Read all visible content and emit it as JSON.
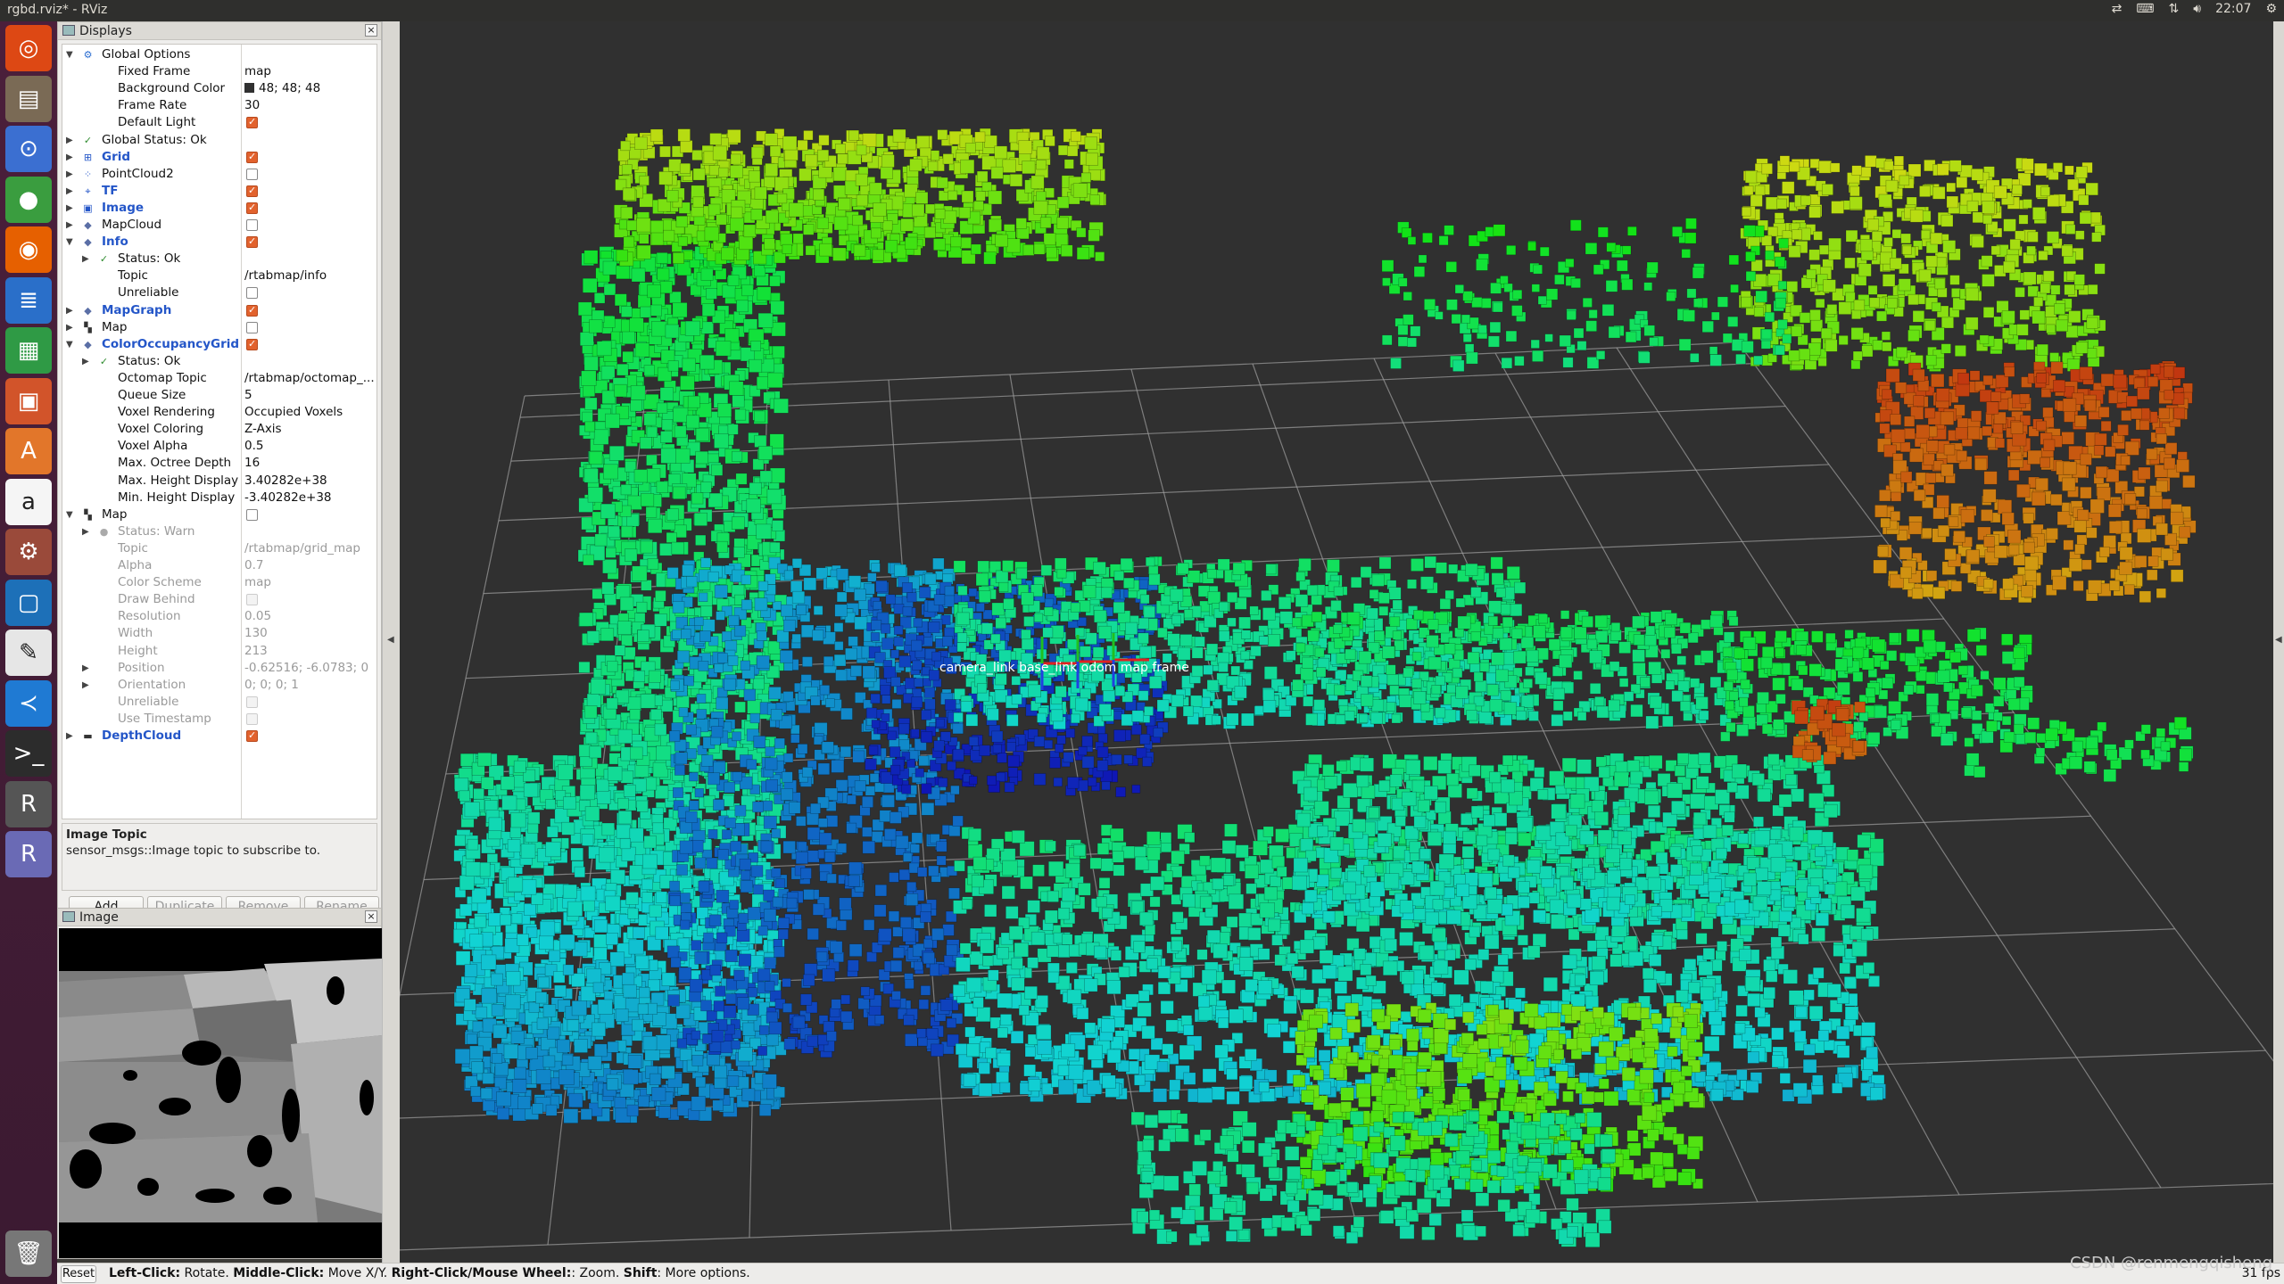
{
  "window": {
    "title": "rgbd.rviz* - RViz"
  },
  "tray": {
    "clock": "22:07"
  },
  "launcher": {
    "items": [
      "ubuntu-home",
      "files",
      "search",
      "chrome",
      "firefox",
      "writer",
      "calc",
      "impress",
      "software-center",
      "amazon",
      "settings",
      "virtualbox",
      "text-editor",
      "vscode",
      "terminal",
      "rviz",
      "rstudio"
    ],
    "trash": "trash"
  },
  "displays": {
    "title": "Displays",
    "tree": [
      {
        "indent": 0,
        "arrow": "▼",
        "icon": "gear",
        "label": "Global Options",
        "value": "",
        "check": null,
        "style": ""
      },
      {
        "indent": 1,
        "arrow": "",
        "icon": "",
        "label": "Fixed Frame",
        "value": "map",
        "check": null,
        "style": ""
      },
      {
        "indent": 1,
        "arrow": "",
        "icon": "",
        "label": "Background Color",
        "value": "48; 48; 48",
        "check": null,
        "style": "",
        "swatch": true
      },
      {
        "indent": 1,
        "arrow": "",
        "icon": "",
        "label": "Frame Rate",
        "value": "30",
        "check": null,
        "style": ""
      },
      {
        "indent": 1,
        "arrow": "",
        "icon": "",
        "label": "Default Light",
        "value": "",
        "check": "on",
        "style": ""
      },
      {
        "indent": 0,
        "arrow": "▶",
        "icon": "ok",
        "label": "Global Status: Ok",
        "value": "",
        "check": null,
        "style": ""
      },
      {
        "indent": 0,
        "arrow": "▶",
        "icon": "grid",
        "label": "Grid",
        "value": "",
        "check": "on",
        "style": "blue"
      },
      {
        "indent": 0,
        "arrow": "▶",
        "icon": "cloud",
        "label": "PointCloud2",
        "value": "",
        "check": "off",
        "style": ""
      },
      {
        "indent": 0,
        "arrow": "▶",
        "icon": "tf",
        "label": "TF",
        "value": "",
        "check": "on",
        "style": "blue"
      },
      {
        "indent": 0,
        "arrow": "▶",
        "icon": "image",
        "label": "Image",
        "value": "",
        "check": "on",
        "style": "blue"
      },
      {
        "indent": 0,
        "arrow": "▶",
        "icon": "diamond",
        "label": "MapCloud",
        "value": "",
        "check": "off",
        "style": ""
      },
      {
        "indent": 0,
        "arrow": "▼",
        "icon": "diamond",
        "label": "Info",
        "value": "",
        "check": "on",
        "style": "blue"
      },
      {
        "indent": 1,
        "arrow": "▶",
        "icon": "ok",
        "label": "Status: Ok",
        "value": "",
        "check": null,
        "style": ""
      },
      {
        "indent": 1,
        "arrow": "",
        "icon": "",
        "label": "Topic",
        "value": "/rtabmap/info",
        "check": null,
        "style": ""
      },
      {
        "indent": 1,
        "arrow": "",
        "icon": "",
        "label": "Unreliable",
        "value": "",
        "check": "off",
        "style": ""
      },
      {
        "indent": 0,
        "arrow": "▶",
        "icon": "diamond",
        "label": "MapGraph",
        "value": "",
        "check": "on",
        "style": "blue"
      },
      {
        "indent": 0,
        "arrow": "▶",
        "icon": "map",
        "label": "Map",
        "value": "",
        "check": "off",
        "style": ""
      },
      {
        "indent": 0,
        "arrow": "▼",
        "icon": "diamond",
        "label": "ColorOccupancyGrid",
        "value": "",
        "check": "on",
        "style": "blue"
      },
      {
        "indent": 1,
        "arrow": "▶",
        "icon": "ok",
        "label": "Status: Ok",
        "value": "",
        "check": null,
        "style": ""
      },
      {
        "indent": 1,
        "arrow": "",
        "icon": "",
        "label": "Octomap Topic",
        "value": "/rtabmap/octomap_...",
        "check": null,
        "style": ""
      },
      {
        "indent": 1,
        "arrow": "",
        "icon": "",
        "label": "Queue Size",
        "value": "5",
        "check": null,
        "style": ""
      },
      {
        "indent": 1,
        "arrow": "",
        "icon": "",
        "label": "Voxel Rendering",
        "value": "Occupied Voxels",
        "check": null,
        "style": ""
      },
      {
        "indent": 1,
        "arrow": "",
        "icon": "",
        "label": "Voxel Coloring",
        "value": "Z-Axis",
        "check": null,
        "style": ""
      },
      {
        "indent": 1,
        "arrow": "",
        "icon": "",
        "label": "Voxel Alpha",
        "value": "0.5",
        "check": null,
        "style": ""
      },
      {
        "indent": 1,
        "arrow": "",
        "icon": "",
        "label": "Max. Octree Depth",
        "value": "16",
        "check": null,
        "style": ""
      },
      {
        "indent": 1,
        "arrow": "",
        "icon": "",
        "label": "Max. Height Display",
        "value": "3.40282e+38",
        "check": null,
        "style": ""
      },
      {
        "indent": 1,
        "arrow": "",
        "icon": "",
        "label": "Min. Height Display",
        "value": "-3.40282e+38",
        "check": null,
        "style": ""
      },
      {
        "indent": 0,
        "arrow": "▼",
        "icon": "map",
        "label": "Map",
        "value": "",
        "check": "off",
        "style": ""
      },
      {
        "indent": 1,
        "arrow": "▶",
        "icon": "warn",
        "label": "Status: Warn",
        "value": "",
        "check": null,
        "style": "dim"
      },
      {
        "indent": 1,
        "arrow": "",
        "icon": "",
        "label": "Topic",
        "value": "/rtabmap/grid_map",
        "check": null,
        "style": "dim"
      },
      {
        "indent": 1,
        "arrow": "",
        "icon": "",
        "label": "Alpha",
        "value": "0.7",
        "check": null,
        "style": "dim"
      },
      {
        "indent": 1,
        "arrow": "",
        "icon": "",
        "label": "Color Scheme",
        "value": "map",
        "check": null,
        "style": "dim"
      },
      {
        "indent": 1,
        "arrow": "",
        "icon": "",
        "label": "Draw Behind",
        "value": "",
        "check": "dim",
        "style": "dim"
      },
      {
        "indent": 1,
        "arrow": "",
        "icon": "",
        "label": "Resolution",
        "value": "0.05",
        "check": null,
        "style": "dim"
      },
      {
        "indent": 1,
        "arrow": "",
        "icon": "",
        "label": "Width",
        "value": "130",
        "check": null,
        "style": "dim"
      },
      {
        "indent": 1,
        "arrow": "",
        "icon": "",
        "label": "Height",
        "value": "213",
        "check": null,
        "style": "dim"
      },
      {
        "indent": 1,
        "arrow": "▶",
        "icon": "",
        "label": "Position",
        "value": "-0.62516; -6.0783; 0",
        "check": null,
        "style": "dim"
      },
      {
        "indent": 1,
        "arrow": "▶",
        "icon": "",
        "label": "Orientation",
        "value": "0; 0; 0; 1",
        "check": null,
        "style": "dim"
      },
      {
        "indent": 1,
        "arrow": "",
        "icon": "",
        "label": "Unreliable",
        "value": "",
        "check": "dim",
        "style": "dim"
      },
      {
        "indent": 1,
        "arrow": "",
        "icon": "",
        "label": "Use Timestamp",
        "value": "",
        "check": "dim",
        "style": "dim"
      },
      {
        "indent": 0,
        "arrow": "▶",
        "icon": "depth",
        "label": "DepthCloud",
        "value": "",
        "check": "on",
        "style": "blue"
      }
    ],
    "description": {
      "heading": "Image Topic",
      "text": "sensor_msgs::Image topic to subscribe to."
    },
    "buttons": {
      "add": "Add",
      "duplicate": "Duplicate",
      "remove": "Remove",
      "rename": "Rename"
    }
  },
  "image_panel": {
    "title": "Image"
  },
  "view3d": {
    "background": "#303030",
    "frame_label": "camera_link / base_link / odom / map frames"
  },
  "statusbar": {
    "reset": "Reset",
    "help": [
      {
        "b": "Left-Click:",
        "t": " Rotate. "
      },
      {
        "b": "Middle-Click:",
        "t": " Move X/Y. "
      },
      {
        "b": "Right-Click/Mouse Wheel:",
        "t": ": Zoom. "
      },
      {
        "b": "Shift",
        "t": ": More options."
      }
    ],
    "fps": "31 fps"
  },
  "watermark": "CSDN @renmengqisheng"
}
